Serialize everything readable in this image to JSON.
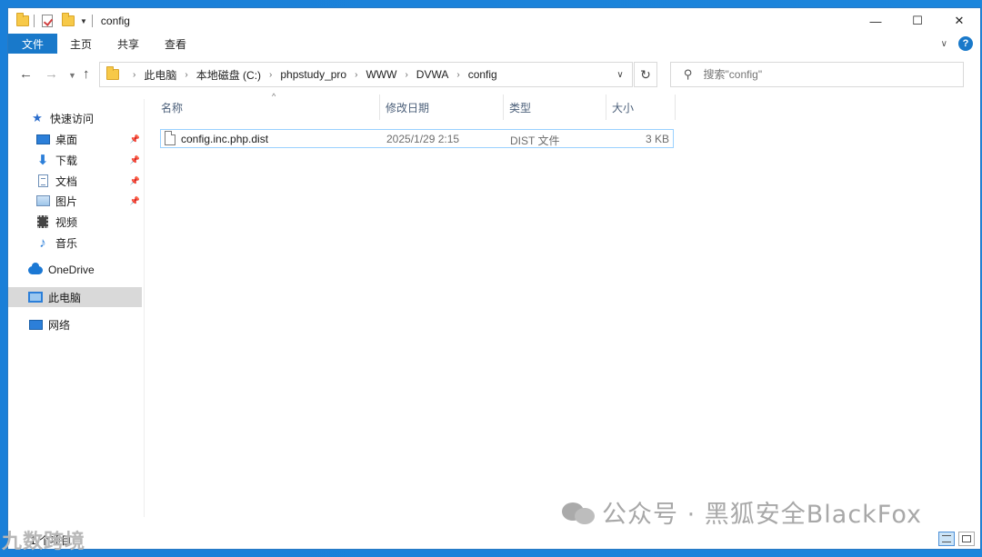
{
  "window": {
    "title": "config"
  },
  "ribbon": {
    "tabs": [
      "文件",
      "主页",
      "共享",
      "查看"
    ]
  },
  "address": {
    "crumbs": [
      "此电脑",
      "本地磁盘 (C:)",
      "phpstudy_pro",
      "WWW",
      "DVWA",
      "config"
    ]
  },
  "search": {
    "placeholder": "搜索\"config\""
  },
  "nav": {
    "quick_access": "快速访问",
    "items": [
      "桌面",
      "下载",
      "文档",
      "图片",
      "视频",
      "音乐"
    ],
    "onedrive": "OneDrive",
    "thispc": "此电脑",
    "network": "网络"
  },
  "columns": {
    "name": "名称",
    "date": "修改日期",
    "type": "类型",
    "size": "大小"
  },
  "files": [
    {
      "name": "config.inc.php.dist",
      "date": "2025/1/29 2:15",
      "type": "DIST 文件",
      "size": "3 KB"
    }
  ],
  "status": {
    "count": "1 个项目"
  },
  "watermark": {
    "text": "公众号 · 黑狐安全BlackFox",
    "brand": "九数跨境"
  }
}
